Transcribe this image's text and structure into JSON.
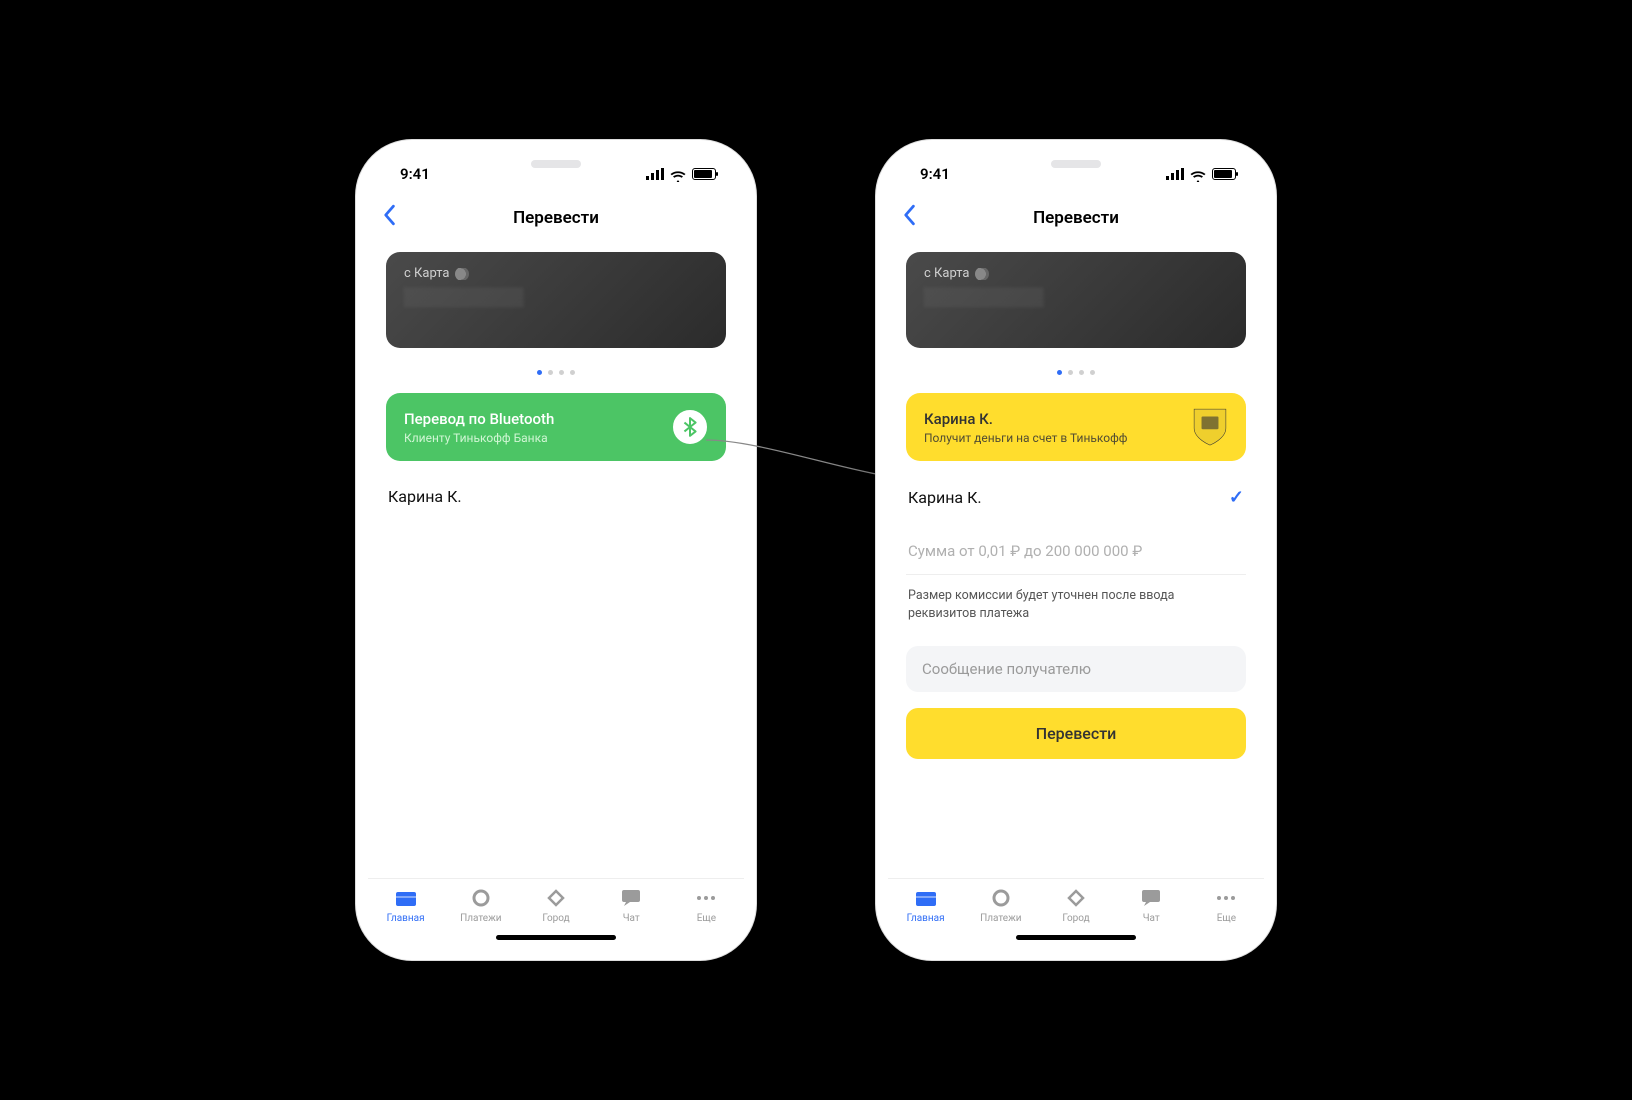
{
  "status": {
    "time": "9:41"
  },
  "header": {
    "title": "Перевести"
  },
  "source_card": {
    "label": "с Карта"
  },
  "screen1": {
    "banner": {
      "title": "Перевод по Bluetooth",
      "subtitle": "Клиенту Тинькофф Банка"
    },
    "contact": "Карина К."
  },
  "screen2": {
    "banner": {
      "title": "Карина К.",
      "subtitle": "Получит деньги на счет в Тинькофф"
    },
    "contact": "Карина К.",
    "amount_placeholder": "Сумма от 0,01 ₽ до 200 000 000 ₽",
    "fee_note": "Размер комиссии будет уточнен после ввода реквизитов платежа",
    "message_placeholder": "Сообщение получателю",
    "transfer_button": "Перевести"
  },
  "tabs": {
    "home": "Главная",
    "payments": "Платежи",
    "city": "Город",
    "chat": "Чат",
    "more": "Еще"
  }
}
